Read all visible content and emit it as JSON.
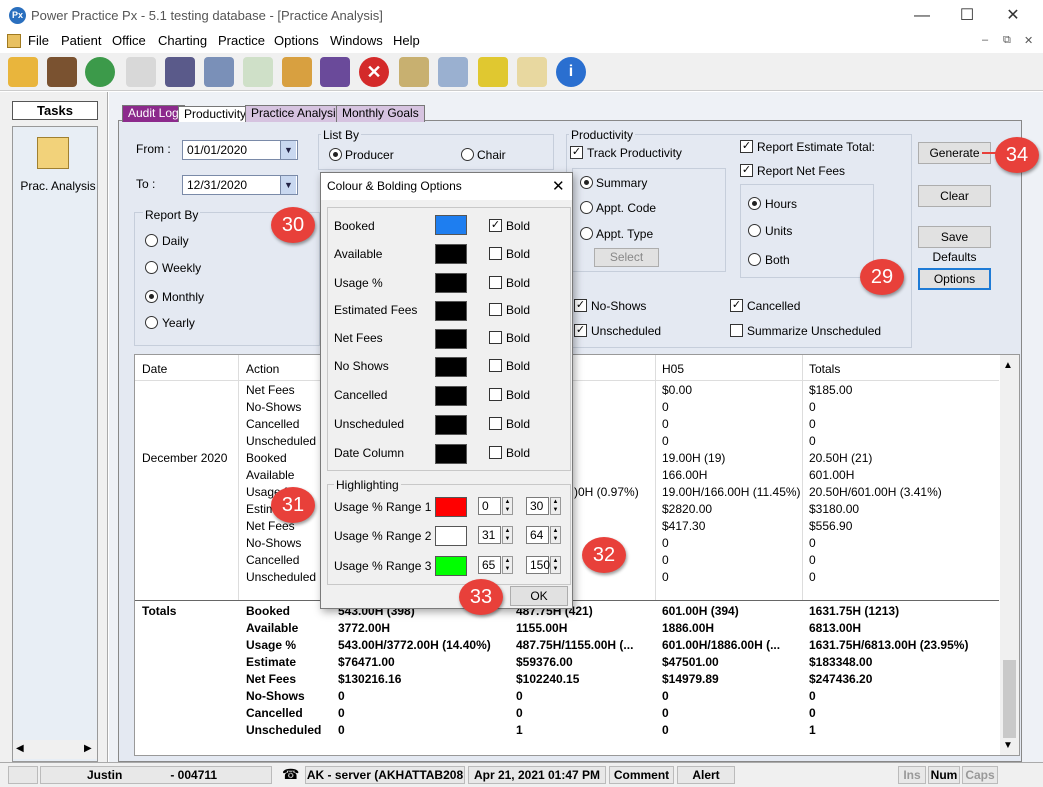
{
  "window": {
    "app_icon_text": "Px",
    "title": "Power Practice Px - 5.1 testing database - [Practice Analysis]",
    "minimize": "—",
    "maximize": "☐",
    "close": "✕"
  },
  "menu": [
    "File",
    "Patient",
    "Office",
    "Charting",
    "Practice",
    "Options",
    "Windows",
    "Help"
  ],
  "mdi_controls": [
    "‒",
    "⧉",
    "✕"
  ],
  "tasks": {
    "header": "Tasks",
    "item_label": "Prac. Analysis"
  },
  "tabs": [
    "Audit Log",
    "Productivity",
    "Practice Analysis",
    "Monthly Goals"
  ],
  "form": {
    "from_label": "From :",
    "from_value": "01/01/2020",
    "to_label": "To :",
    "to_value": "12/31/2020",
    "report_by_label": "Report By",
    "report_by": [
      "Daily",
      "Weekly",
      "Monthly",
      "Yearly"
    ],
    "report_by_selected": "Monthly",
    "list_by_label": "List By",
    "list_by": [
      "Producer",
      "Chair"
    ],
    "list_by_selected": "Producer",
    "productivity_label": "Productivity",
    "track_productivity": "Track Productivity",
    "productivity_modes": [
      "Summary",
      "Appt. Code",
      "Appt. Type"
    ],
    "productivity_selected": "Summary",
    "select_btn": "Select",
    "report_estimate_total": "Report Estimate Total:",
    "report_net_fees": "Report Net Fees",
    "units": [
      "Hours",
      "Units",
      "Both"
    ],
    "units_selected": "Hours",
    "no_shows": "No-Shows",
    "unscheduled": "Unscheduled",
    "cancelled": "Cancelled",
    "summarize_unscheduled": "Summarize Unscheduled"
  },
  "buttons": {
    "generate": "Generate",
    "clear": "Clear",
    "save_defaults": "Save Defaults",
    "options": "Options"
  },
  "grid": {
    "headers": [
      "Date",
      "Action",
      "H05",
      "Totals"
    ],
    "rows": [
      {
        "date": "",
        "action": "Net Fees",
        "c3": "",
        "h05": "$0.00",
        "totals": "$185.00"
      },
      {
        "date": "",
        "action": "No-Shows",
        "c3": "",
        "h05": "0",
        "totals": "0"
      },
      {
        "date": "",
        "action": "Cancelled",
        "c3": "",
        "h05": "0",
        "totals": "0"
      },
      {
        "date": "",
        "action": "Unscheduled",
        "c3": "",
        "h05": "0",
        "totals": "0"
      },
      {
        "date": "December 2020",
        "action": "Booked",
        "c3": "",
        "h05": "19.00H  (19)",
        "totals": "20.50H  (21)"
      },
      {
        "date": "",
        "action": "Available",
        "c3": "",
        "h05": "166.00H",
        "totals": "601.00H"
      },
      {
        "date": "",
        "action": "Usage %",
        "c3": ")0H  (0.97%)",
        "h05": "19.00H/166.00H  (11.45%)",
        "totals": "20.50H/601.00H  (3.41%)"
      },
      {
        "date": "",
        "action": "Estimate",
        "c3": "",
        "h05": "$2820.00",
        "totals": "$3180.00"
      },
      {
        "date": "",
        "action": "Net Fees",
        "c3": "",
        "h05": "$417.30",
        "totals": "$556.90"
      },
      {
        "date": "",
        "action": "No-Shows",
        "c3": "",
        "h05": "0",
        "totals": "0"
      },
      {
        "date": "",
        "action": "Cancelled",
        "c3": "",
        "h05": "0",
        "totals": "0"
      },
      {
        "date": "",
        "action": "Unscheduled",
        "c3": "",
        "h05": "0",
        "totals": "0"
      }
    ],
    "totals_label": "Totals",
    "totals_rows": [
      {
        "action": "Booked",
        "c1": "543.00H  (398)",
        "c2": "487.75H  (421)",
        "h05": "601.00H  (394)",
        "totals": "1631.75H  (1213)"
      },
      {
        "action": "Available",
        "c1": "3772.00H",
        "c2": "1155.00H",
        "h05": "1886.00H",
        "totals": "6813.00H"
      },
      {
        "action": "Usage %",
        "c1": "543.00H/3772.00H  (14.40%)",
        "c2": "487.75H/1155.00H  (...",
        "h05": "601.00H/1886.00H  (...",
        "totals": "1631.75H/6813.00H  (23.95%)"
      },
      {
        "action": "Estimate",
        "c1": "$76471.00",
        "c2": "$59376.00",
        "h05": "$47501.00",
        "totals": "$183348.00"
      },
      {
        "action": "Net Fees",
        "c1": "$130216.16",
        "c2": "$102240.15",
        "h05": "$14979.89",
        "totals": "$247436.20"
      },
      {
        "action": "No-Shows",
        "c1": "0",
        "c2": "0",
        "h05": "0",
        "totals": "0"
      },
      {
        "action": "Cancelled",
        "c1": "0",
        "c2": "0",
        "h05": "0",
        "totals": "0"
      },
      {
        "action": "Unscheduled",
        "c1": "0",
        "c2": "1",
        "h05": "0",
        "totals": "1"
      }
    ]
  },
  "dialog": {
    "title": "Colour & Bolding Options",
    "rows": [
      {
        "label": "Booked",
        "color": "#1e7ef0",
        "bold": true
      },
      {
        "label": "Available",
        "color": "#000000",
        "bold": false
      },
      {
        "label": "Usage %",
        "color": "#000000",
        "bold": false
      },
      {
        "label": "Estimated Fees",
        "color": "#000000",
        "bold": false
      },
      {
        "label": "Net Fees",
        "color": "#000000",
        "bold": false
      },
      {
        "label": "No Shows",
        "color": "#000000",
        "bold": false
      },
      {
        "label": "Cancelled",
        "color": "#000000",
        "bold": false
      },
      {
        "label": "Unscheduled",
        "color": "#000000",
        "bold": false
      },
      {
        "label": "Date Column",
        "color": "#000000",
        "bold": false
      }
    ],
    "bold_label": "Bold",
    "highlighting_label": "Highlighting",
    "ranges": [
      {
        "label": "Usage % Range 1",
        "color": "#ff0000",
        "min": "0",
        "max": "30"
      },
      {
        "label": "Usage % Range 2",
        "color": "#ffffff",
        "min": "31",
        "max": "64"
      },
      {
        "label": "Usage % Range 3",
        "color": "#00ff00",
        "min": "65",
        "max": "150"
      }
    ],
    "ok": "OK"
  },
  "callouts": [
    "34",
    "29",
    "30",
    "31",
    "32",
    "33"
  ],
  "status": {
    "user": "Justin",
    "id": "- 004711",
    "server": "AK - server (AKHATTAB208",
    "datetime": "Apr 21, 2021 01:47 PM",
    "comment": "Comment",
    "alert": "Alert",
    "ins": "Ins",
    "num": "Num",
    "caps": "Caps"
  }
}
